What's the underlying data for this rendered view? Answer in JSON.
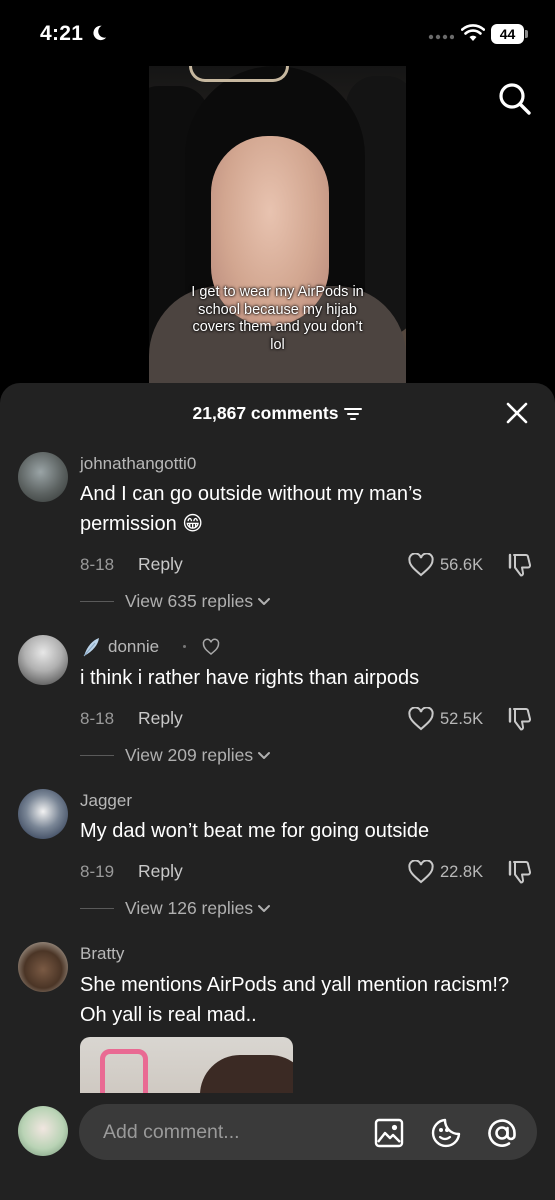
{
  "status_bar": {
    "time": "4:21",
    "battery": "44"
  },
  "video": {
    "caption": "I get to wear my AirPods in school because my hijab covers them and you don’t lol"
  },
  "comments_sheet": {
    "count_label": "21,867 comments",
    "comments": [
      {
        "username": "johnathangotti0",
        "text": "And I can go outside without my man’s permission 😁",
        "date": "8-18",
        "reply_label": "Reply",
        "likes": "56.6K",
        "view_replies": "View 635 replies"
      },
      {
        "username": "donnie",
        "text": "i think i rather have rights than airpods",
        "date": "8-18",
        "reply_label": "Reply",
        "likes": "52.5K",
        "view_replies": "View 209 replies"
      },
      {
        "username": "Jagger",
        "text": "My dad won’t beat me for going outside",
        "date": "8-19",
        "reply_label": "Reply",
        "likes": "22.8K",
        "view_replies": "View 126 replies"
      },
      {
        "username": "Bratty",
        "text": "She mentions AirPods and yall mention racism!? Oh yall is real mad.."
      }
    ]
  },
  "input": {
    "placeholder": "Add comment..."
  }
}
